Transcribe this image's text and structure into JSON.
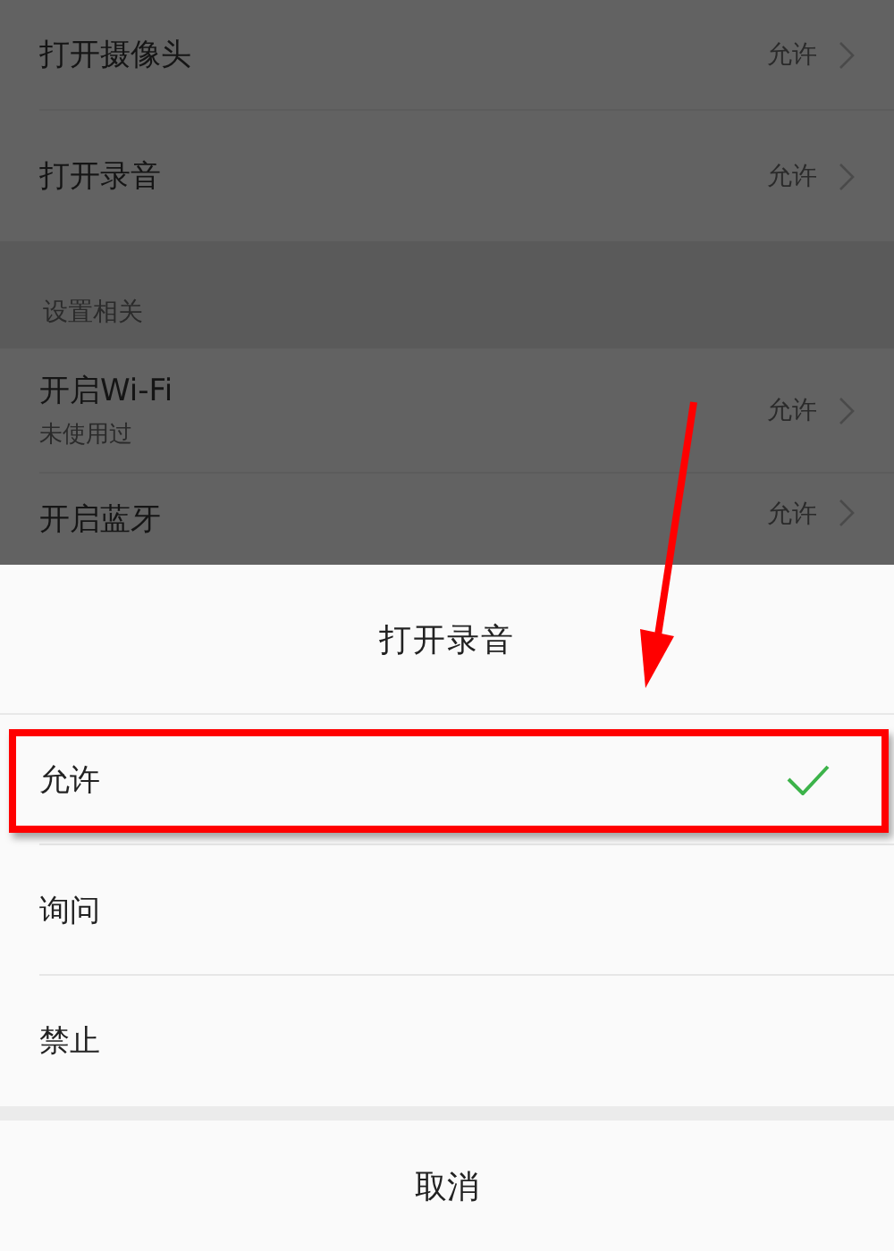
{
  "settings_list": {
    "sections": [
      {
        "rows": [
          {
            "title": "打开摄像头",
            "value": "允许"
          },
          {
            "title": "打开录音",
            "value": "允许"
          }
        ]
      },
      {
        "header": "设置相关",
        "rows": [
          {
            "title": "开启Wi-Fi",
            "subtitle": "未使用过",
            "value": "允许"
          },
          {
            "title": "开启蓝牙",
            "value": "允许"
          }
        ]
      }
    ]
  },
  "sheet": {
    "title": "打开录音",
    "options": [
      {
        "label": "允许",
        "selected": true
      },
      {
        "label": "询问",
        "selected": false
      },
      {
        "label": "禁止",
        "selected": false
      }
    ],
    "cancel": "取消"
  }
}
